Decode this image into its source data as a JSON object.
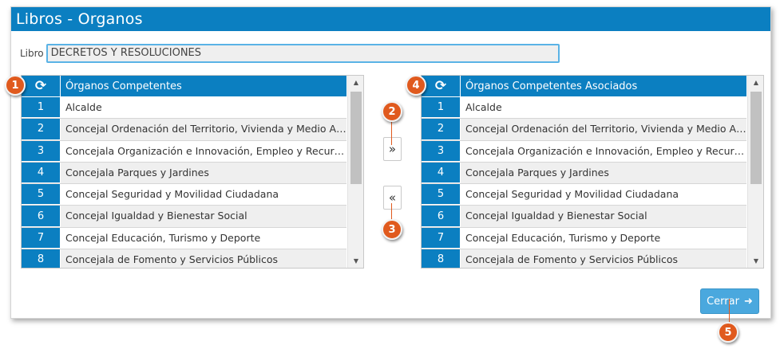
{
  "window": {
    "title": "Libros - Organos"
  },
  "libro": {
    "label": "Libro",
    "value": "DECRETOS Y RESOLUCIONES"
  },
  "left_grid": {
    "header": "Órganos Competentes",
    "rows": [
      {
        "num": "1",
        "text": "Alcalde"
      },
      {
        "num": "2",
        "text": "Concejal Ordenación del Territorio, Vivienda y Medio Ambi..."
      },
      {
        "num": "3",
        "text": "Concejala Organización e Innovación, Empleo y Recursos ..."
      },
      {
        "num": "4",
        "text": "Concejala Parques y Jardines"
      },
      {
        "num": "5",
        "text": "Concejal Seguridad y Movilidad Ciudadana"
      },
      {
        "num": "6",
        "text": "Concejal Igualdad y Bienestar Social"
      },
      {
        "num": "7",
        "text": "Concejal Educación, Turismo y Deporte"
      },
      {
        "num": "8",
        "text": "Concejala de Fomento y Servicios Públicos"
      }
    ]
  },
  "right_grid": {
    "header": "Órganos Competentes Asociados",
    "rows": [
      {
        "num": "1",
        "text": "Alcalde"
      },
      {
        "num": "2",
        "text": "Concejal Ordenación del Territorio, Vivienda y Medio Ambi..."
      },
      {
        "num": "3",
        "text": "Concejala Organización e Innovación, Empleo y Recursos ..."
      },
      {
        "num": "4",
        "text": "Concejala Parques y Jardines"
      },
      {
        "num": "5",
        "text": "Concejal Seguridad y Movilidad Ciudadana"
      },
      {
        "num": "6",
        "text": "Concejal Igualdad y Bienestar Social"
      },
      {
        "num": "7",
        "text": "Concejal Educación, Turismo y Deporte"
      },
      {
        "num": "8",
        "text": "Concejala de Fomento y Servicios Públicos"
      }
    ]
  },
  "buttons": {
    "add_glyph": "»",
    "remove_glyph": "«",
    "close_label": "Cerrar"
  },
  "icons": {
    "refresh": "refresh-icon",
    "add": "double-chevron-right-icon",
    "remove": "double-chevron-left-icon",
    "exit": "exit-icon"
  },
  "callouts": [
    "1",
    "2",
    "3",
    "4",
    "5"
  ],
  "colors": {
    "accent": "#0b7fc1",
    "button": "#4aa8de",
    "callout": "#e05a1e"
  }
}
